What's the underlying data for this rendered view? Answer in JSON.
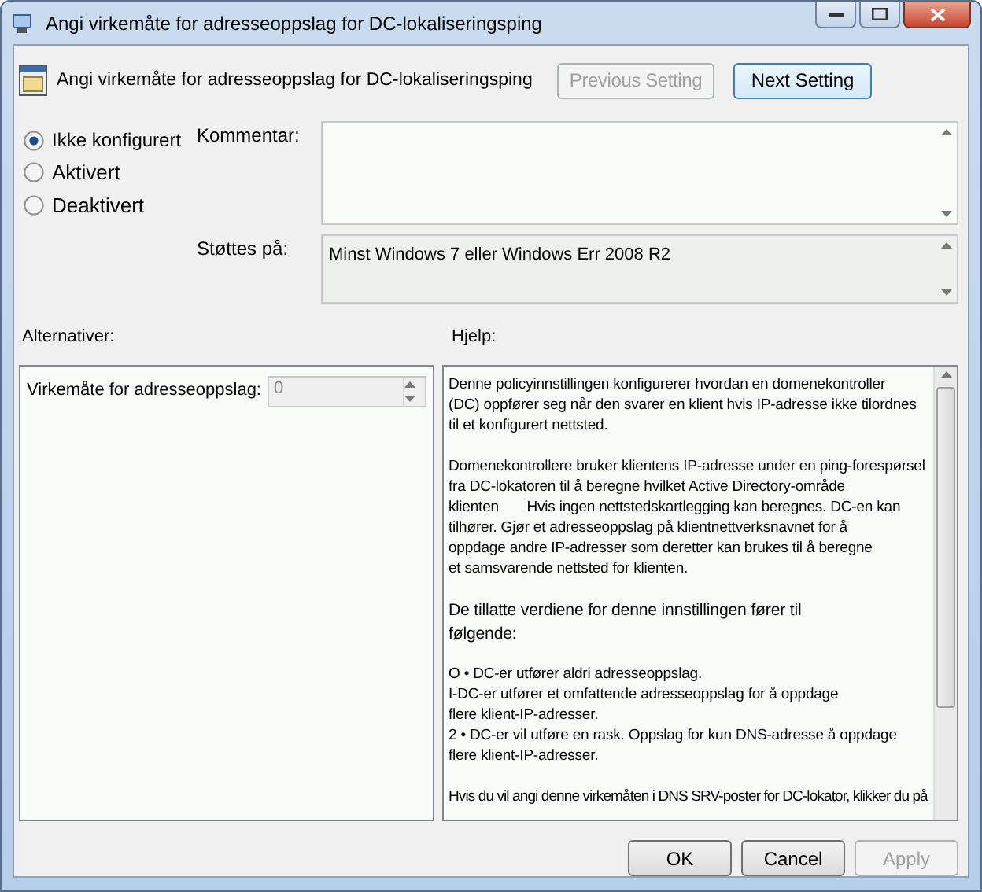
{
  "window": {
    "title": "Angi virkemåte for adresseoppslag for DC-lokaliseringsping"
  },
  "header": {
    "title": "Angi virkemåte for adresseoppslag for DC-lokaliseringsping"
  },
  "nav_buttons": [
    {
      "label": "Previous Setting",
      "disabled": true
    },
    {
      "label": "Next Setting",
      "disabled": false
    }
  ],
  "options": [
    {
      "label": "Ikke konfigurert",
      "selected": true
    },
    {
      "label": "Aktivert",
      "selected": false
    },
    {
      "label": "Deaktivert",
      "selected": false
    }
  ],
  "comment": {
    "label": "Kommentar:"
  },
  "supported": {
    "label": "Støttes på:",
    "value": "Minst Windows 7 eller Windows Err 2008 R2"
  },
  "options_panel": {
    "label": "Alternativer:",
    "setting_label": "Virkemåte for adresseoppslag:",
    "setting_value": "0"
  },
  "help_panel": {
    "label": "Hjelp:",
    "paragraphs": [
      {
        "lines": [
          "Denne policyinnstillingen konfigurerer hvordan en domenekontroller",
          "(DC) oppfører seg når den svarer en klient hvis IP-adresse ikke tilordnes",
          "til et konfigurert nettsted."
        ]
      },
      {
        "lines": [
          "Domenekontrollere bruker klientens IP-adresse under en ping-forespørsel",
          "fra DC-lokatoren til å beregne hvilket Active Directory-område",
          "klienten       Hvis ingen nettstedskartlegging kan beregnes. DC-en kan",
          "tilhører. Gjør et adresseoppslag på klientnettverksnavnet for å",
          "oppdage andre IP-adresser som deretter kan brukes til å beregne",
          "et samsvarende nettsted for klienten."
        ]
      },
      {
        "lines": [
          "De tillatte verdiene for denne innstillingen fører til",
          "følgende:"
        ]
      },
      {
        "lines": [
          "O • DC-er utfører aldri adresseoppslag.",
          "I-DC-er utfører et omfattende adresseoppslag for å oppdage",
          "flere klient-IP-adresser.",
          "2 • DC-er vil utføre en rask. Oppslag for kun DNS-adresse å oppdage",
          "flere klient-IP-adresser."
        ]
      },
      {
        "lines": [
          "Hvis du vil angi denne virkemåten i DNS SRV-poster for DC-lokator, klikker du på"
        ]
      }
    ]
  },
  "buttons": [
    {
      "label": "OK",
      "disabled": false
    },
    {
      "label": "Cancel",
      "disabled": false
    },
    {
      "label": "Apply",
      "disabled": true
    }
  ]
}
